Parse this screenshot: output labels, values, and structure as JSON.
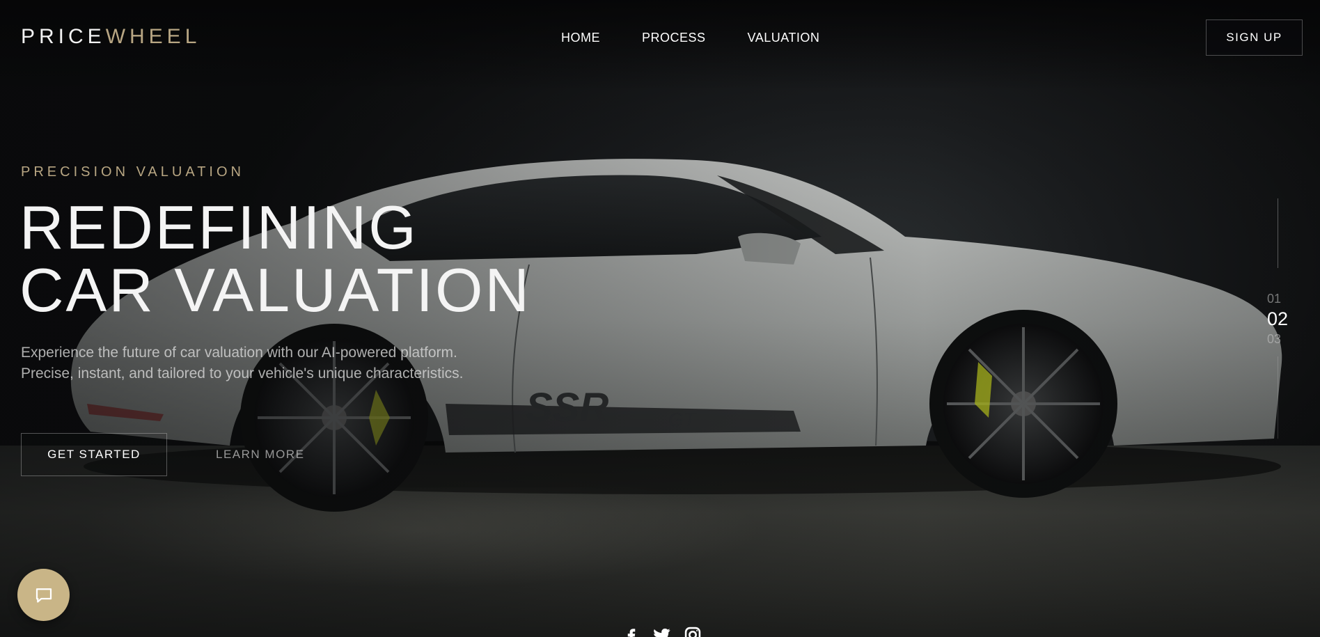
{
  "brand": {
    "part1": "PRICE",
    "part2": "WHEEL"
  },
  "nav": [
    {
      "label": "HOME"
    },
    {
      "label": "PROCESS"
    },
    {
      "label": "VALUATION"
    }
  ],
  "header": {
    "signup_label": "SIGN UP"
  },
  "hero": {
    "eyebrow": "PRECISION VALUATION",
    "headline_line1": "REDEFINING",
    "headline_line2": "CAR VALUATION",
    "lead": "Experience the future of car valuation with our AI-powered platform. Precise, instant, and tailored to your vehicle's unique characteristics.",
    "primary_cta": "GET STARTED",
    "secondary_cta": "LEARN MORE"
  },
  "slides": {
    "items": [
      "01",
      "02",
      "03"
    ],
    "active": "02"
  },
  "chat": {
    "icon": "chat-bubble-icon"
  },
  "social": [
    "facebook-icon",
    "twitter-icon",
    "instagram-icon"
  ],
  "colors": {
    "accent": "#b8a683",
    "chat_button": "#c9b587",
    "background": "#0c0d0e"
  }
}
